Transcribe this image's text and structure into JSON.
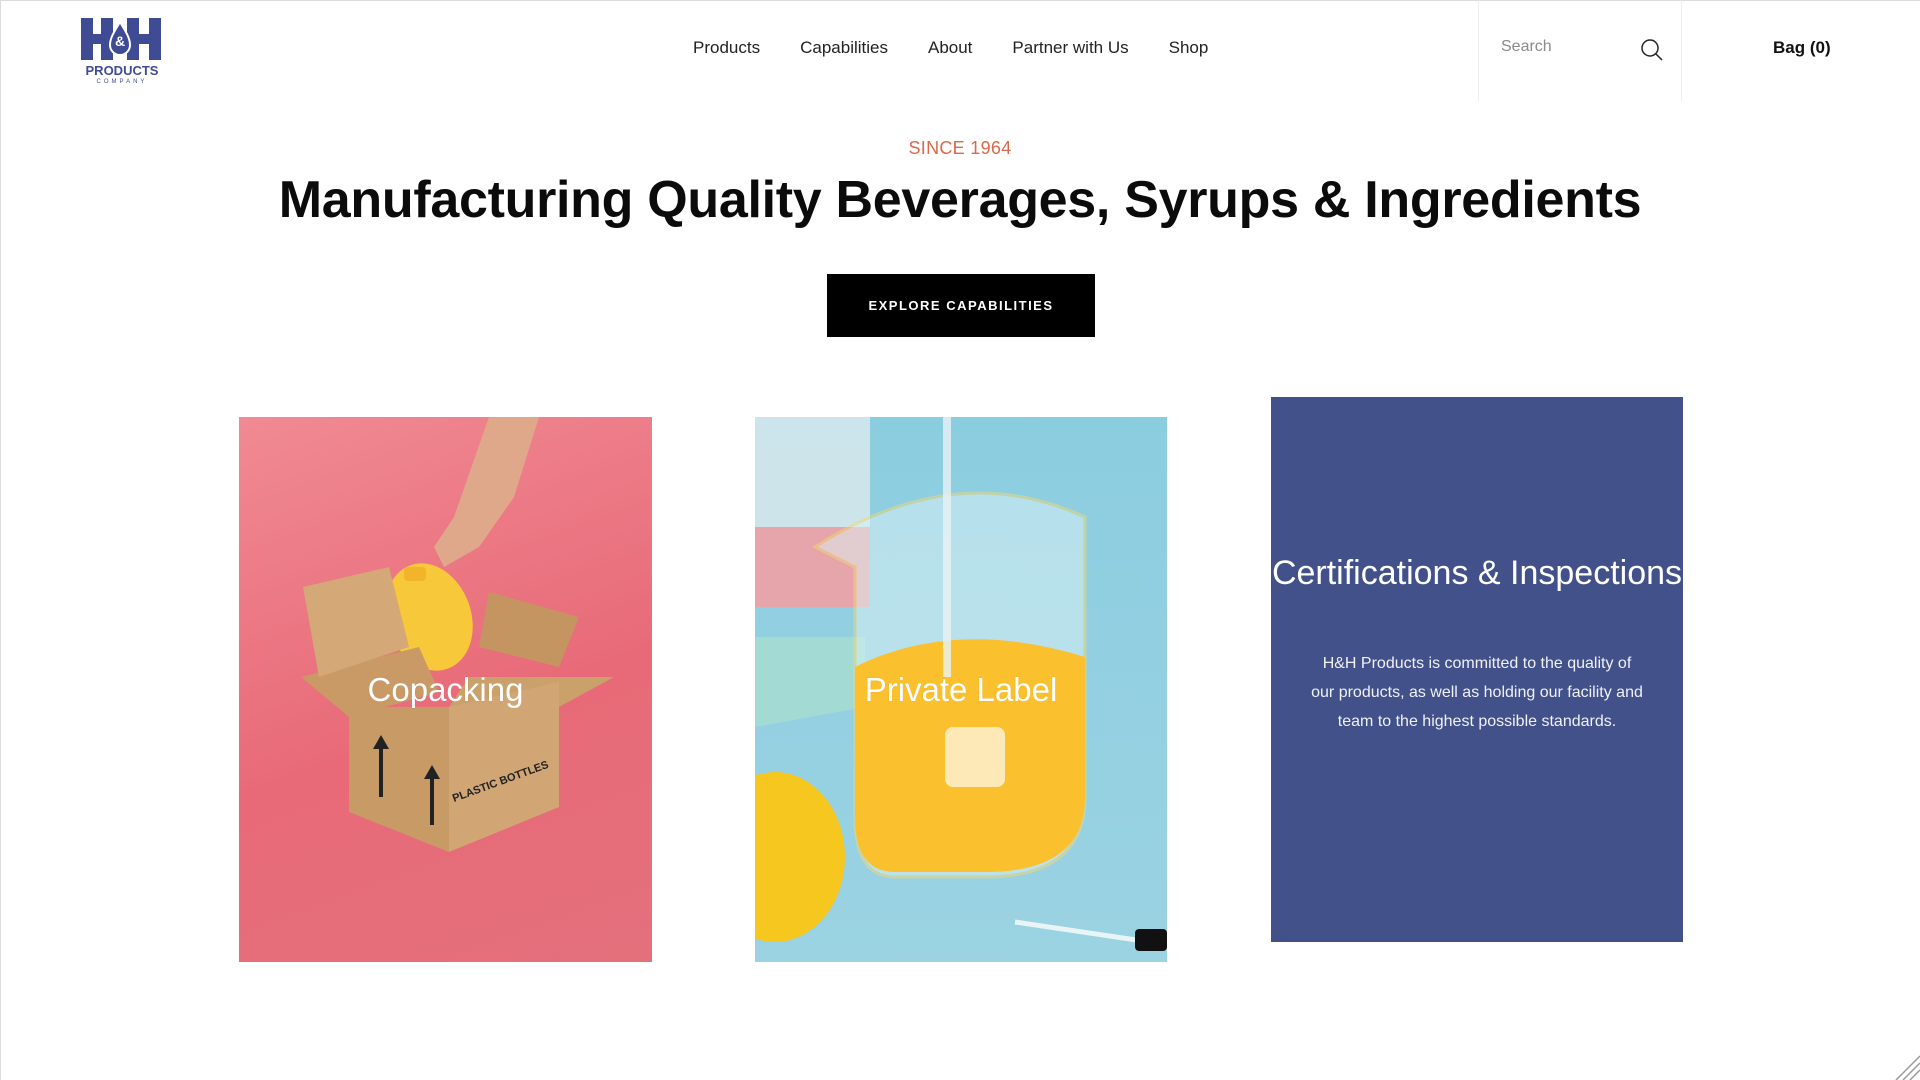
{
  "brand": {
    "logo_top": "H&H",
    "logo_line1": "PRODUCTS",
    "logo_line2": "COMPANY",
    "color": "#3f4c94"
  },
  "nav": {
    "items": [
      {
        "label": "Products"
      },
      {
        "label": "Capabilities"
      },
      {
        "label": "About"
      },
      {
        "label": "Partner with Us"
      },
      {
        "label": "Shop"
      }
    ]
  },
  "search": {
    "placeholder": "Search",
    "value": "",
    "icon": "search-icon"
  },
  "bag": {
    "label": "Bag (0)",
    "count": 0
  },
  "hero": {
    "eyebrow": "SINCE 1964",
    "title": "Manufacturing Quality Beverages, Syrups & Ingredients",
    "cta_label": "EXPLORE CAPABILITIES",
    "eyebrow_color": "#d9694a"
  },
  "cards": [
    {
      "label": "Copacking",
      "image": "hand placing yellow jug into cardboard box on pink background"
    },
    {
      "label": "Private Label",
      "image": "yellow liquid in glass beaker with lemon on blue background"
    },
    {
      "title": "Certifications & Inspections",
      "body": "H&H Products is committed to the quality of our products, as well as holding our facility and team to the highest possible standards.",
      "background": "#42518a"
    }
  ]
}
